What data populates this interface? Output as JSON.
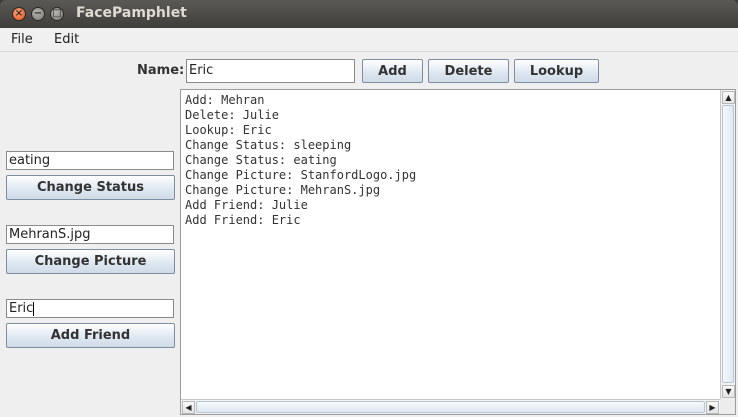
{
  "window": {
    "title": "FacePamphlet",
    "controls": {
      "close": "×",
      "minimize": "−",
      "maximize": "□"
    }
  },
  "menubar": {
    "items": [
      "File",
      "Edit"
    ]
  },
  "toolbar": {
    "name_label": "Name:",
    "name_value": "Eric",
    "add_label": "Add",
    "delete_label": "Delete",
    "lookup_label": "Lookup"
  },
  "sidebar": {
    "status_value": "eating",
    "status_button": "Change Status",
    "picture_value": "MehranS.jpg",
    "picture_button": "Change Picture",
    "friend_value": "Eric",
    "friend_button": "Add Friend"
  },
  "log": {
    "lines": [
      "Add: Mehran",
      "Delete: Julie",
      "Lookup: Eric",
      "Change Status: sleeping",
      "Change Status: eating",
      "Change Picture: StanfordLogo.jpg",
      "Change Picture: MehranS.jpg",
      "Add Friend: Julie",
      "Add Friend: Eric"
    ]
  },
  "scrollbars": {
    "up": "▲",
    "down": "▼",
    "left": "◀",
    "right": "▶"
  }
}
